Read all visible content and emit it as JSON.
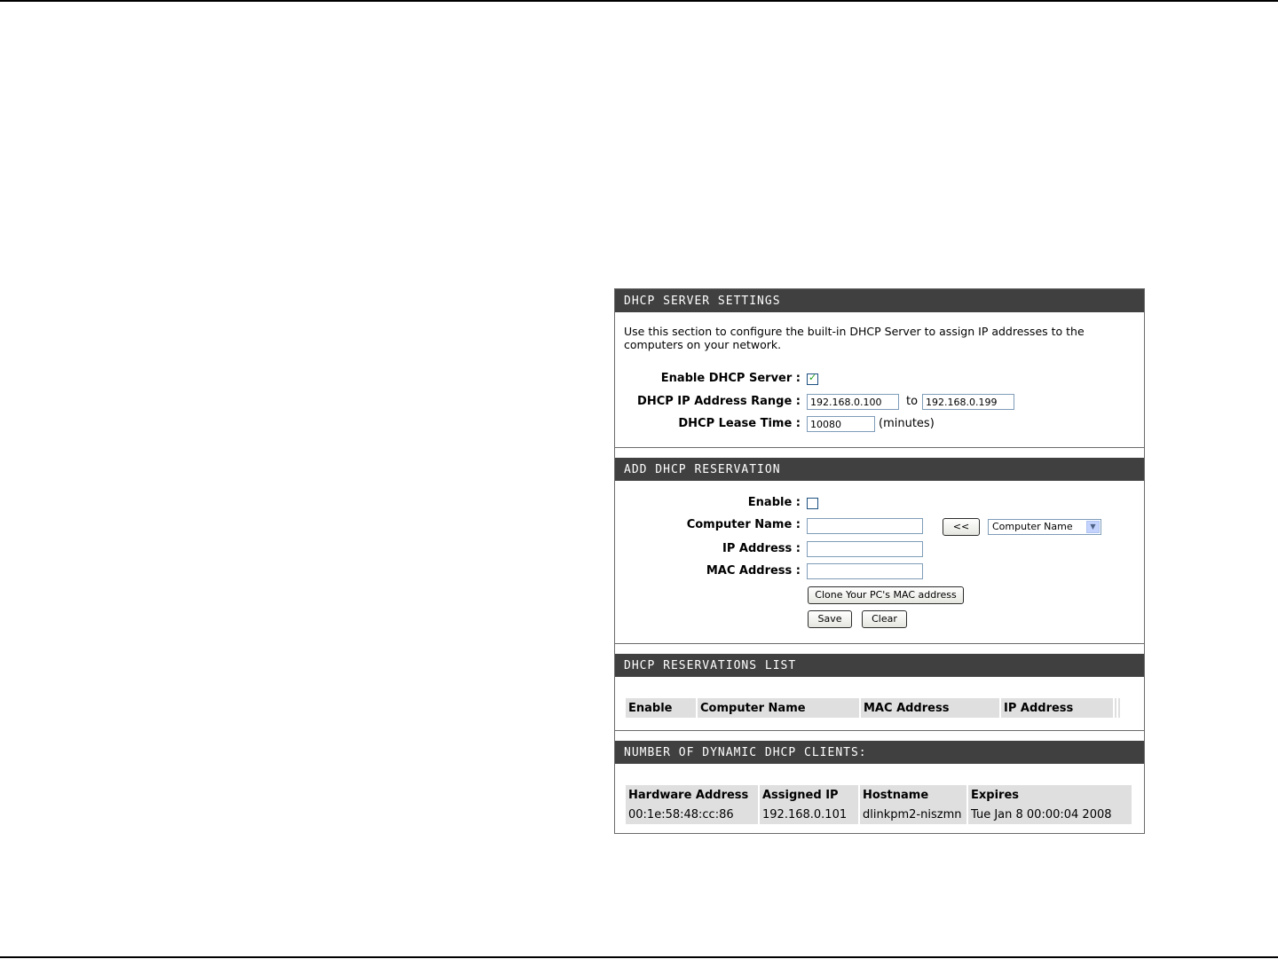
{
  "server_settings": {
    "title": "DHCP SERVER SETTINGS",
    "description": "Use this section to configure the built-in DHCP Server to assign IP addresses to the computers on your network.",
    "enable_label": "Enable DHCP Server :",
    "enable_checked": true,
    "range_label": "DHCP IP Address Range :",
    "range_start": "192.168.0.100",
    "range_to": "to",
    "range_end": "192.168.0.199",
    "lease_label": "DHCP Lease Time :",
    "lease_value": "10080",
    "lease_unit": "(minutes)"
  },
  "reservation": {
    "title": "ADD DHCP RESERVATION",
    "enable_label": "Enable :",
    "enable_checked": false,
    "computer_name_label": "Computer Name :",
    "computer_name_value": "",
    "copy_button": "<<",
    "computer_select": "Computer Name",
    "ip_label": "IP Address :",
    "ip_value": "",
    "mac_label": "MAC Address :",
    "mac_value": "",
    "clone_button": "Clone Your PC's MAC address",
    "save_button": "Save",
    "clear_button": "Clear"
  },
  "reservations_list": {
    "title": "DHCP RESERVATIONS LIST",
    "columns": [
      "Enable",
      "Computer Name",
      "MAC Address",
      "IP Address"
    ]
  },
  "dynamic_clients": {
    "title": "NUMBER OF DYNAMIC DHCP CLIENTS:",
    "columns": [
      "Hardware Address",
      "Assigned IP",
      "Hostname",
      "Expires"
    ],
    "rows": [
      [
        "00:1e:58:48:cc:86",
        "192.168.0.101",
        "dlinkpm2-niszmn",
        "Tue Jan 8 00:00:04 2008"
      ]
    ]
  }
}
